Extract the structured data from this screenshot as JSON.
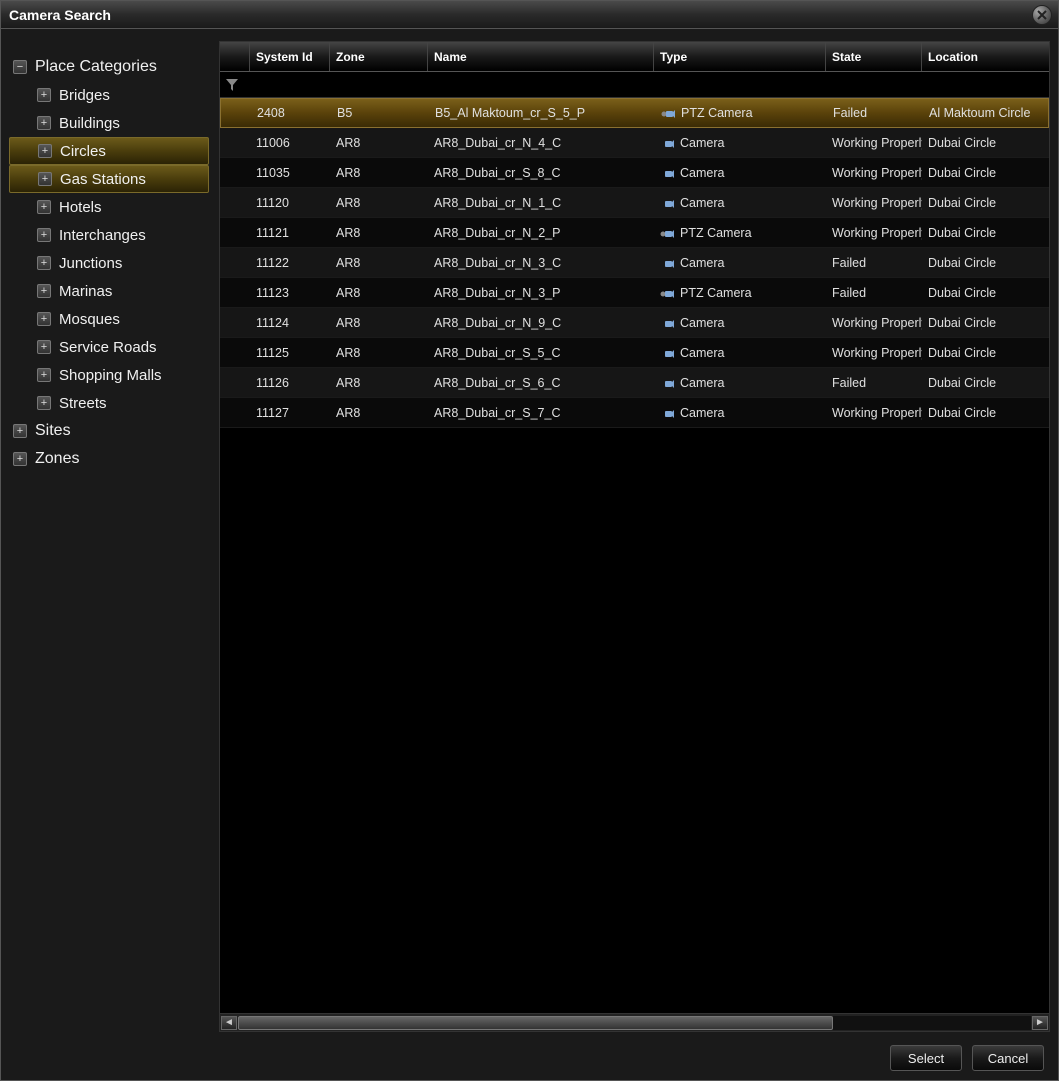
{
  "window": {
    "title": "Camera Search",
    "close_icon": "close-icon"
  },
  "tree": {
    "root_items": [
      {
        "label": "Place Categories",
        "expanded": true,
        "children": [
          {
            "label": "Bridges",
            "highlight": false
          },
          {
            "label": "Buildings",
            "highlight": false
          },
          {
            "label": "Circles",
            "highlight": true
          },
          {
            "label": "Gas Stations",
            "highlight": true
          },
          {
            "label": "Hotels",
            "highlight": false
          },
          {
            "label": "Interchanges",
            "highlight": false
          },
          {
            "label": "Junctions",
            "highlight": false
          },
          {
            "label": "Marinas",
            "highlight": false
          },
          {
            "label": "Mosques",
            "highlight": false
          },
          {
            "label": "Service Roads",
            "highlight": false
          },
          {
            "label": "Shopping Malls",
            "highlight": false
          },
          {
            "label": "Streets",
            "highlight": false
          }
        ]
      },
      {
        "label": "Sites",
        "expanded": false,
        "children": []
      },
      {
        "label": "Zones",
        "expanded": false,
        "children": []
      }
    ]
  },
  "table": {
    "columns": {
      "system_id": "System Id",
      "zone": "Zone",
      "name": "Name",
      "type": "Type",
      "state": "State",
      "location": "Location"
    },
    "rows": [
      {
        "selected": true,
        "system_id": "2408",
        "zone": "B5",
        "name": "B5_Al Maktoum_cr_S_5_P",
        "type": "PTZ Camera",
        "state": "Failed",
        "location": "Al Maktoum Circle"
      },
      {
        "selected": false,
        "system_id": "11006",
        "zone": "AR8",
        "name": "AR8_Dubai_cr_N_4_C",
        "type": "Camera",
        "state": "Working Properly",
        "location": "Dubai Circle"
      },
      {
        "selected": false,
        "system_id": "11035",
        "zone": "AR8",
        "name": "AR8_Dubai_cr_S_8_C",
        "type": "Camera",
        "state": "Working Properly",
        "location": "Dubai Circle"
      },
      {
        "selected": false,
        "system_id": "11120",
        "zone": "AR8",
        "name": "AR8_Dubai_cr_N_1_C",
        "type": "Camera",
        "state": "Working Properly",
        "location": "Dubai Circle"
      },
      {
        "selected": false,
        "system_id": "11121",
        "zone": "AR8",
        "name": "AR8_Dubai_cr_N_2_P",
        "type": "PTZ Camera",
        "state": "Working Properly",
        "location": "Dubai Circle"
      },
      {
        "selected": false,
        "system_id": "11122",
        "zone": "AR8",
        "name": "AR8_Dubai_cr_N_3_C",
        "type": "Camera",
        "state": "Failed",
        "location": "Dubai Circle"
      },
      {
        "selected": false,
        "system_id": "11123",
        "zone": "AR8",
        "name": "AR8_Dubai_cr_N_3_P",
        "type": "PTZ Camera",
        "state": "Failed",
        "location": "Dubai Circle"
      },
      {
        "selected": false,
        "system_id": "11124",
        "zone": "AR8",
        "name": "AR8_Dubai_cr_N_9_C",
        "type": "Camera",
        "state": "Working Properly",
        "location": "Dubai Circle"
      },
      {
        "selected": false,
        "system_id": "11125",
        "zone": "AR8",
        "name": "AR8_Dubai_cr_S_5_C",
        "type": "Camera",
        "state": "Working Properly",
        "location": "Dubai Circle"
      },
      {
        "selected": false,
        "system_id": "11126",
        "zone": "AR8",
        "name": "AR8_Dubai_cr_S_6_C",
        "type": "Camera",
        "state": "Failed",
        "location": "Dubai Circle"
      },
      {
        "selected": false,
        "system_id": "11127",
        "zone": "AR8",
        "name": "AR8_Dubai_cr_S_7_C",
        "type": "Camera",
        "state": "Working Properly",
        "location": "Dubai Circle"
      }
    ]
  },
  "footer": {
    "select": "Select",
    "cancel": "Cancel"
  }
}
